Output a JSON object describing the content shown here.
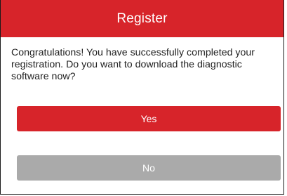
{
  "dialog": {
    "title": "Register",
    "message": "Congratulations! You have successfully completed your registration. Do you want to download the diagnostic software now?",
    "yes_label": "Yes",
    "no_label": "No"
  },
  "colors": {
    "accent": "#d7242a",
    "secondary_button": "#aaaaaa",
    "text": "#222222"
  }
}
